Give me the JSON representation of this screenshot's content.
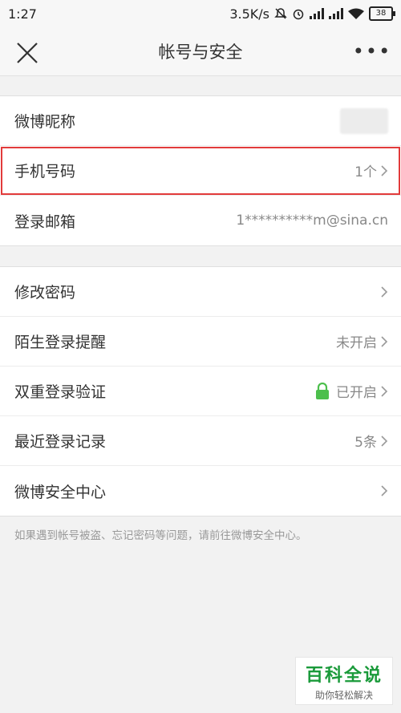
{
  "status": {
    "time": "1:27",
    "speed": "3.5K/s",
    "battery": "38"
  },
  "nav": {
    "title": "帐号与安全",
    "more": "•••"
  },
  "group1": [
    {
      "label": "微博昵称",
      "value": ""
    },
    {
      "label": "手机号码",
      "value": "1个"
    },
    {
      "label": "登录邮箱",
      "value": "1**********m@sina.cn"
    }
  ],
  "group2": [
    {
      "label": "修改密码",
      "value": ""
    },
    {
      "label": "陌生登录提醒",
      "value": "未开启"
    },
    {
      "label": "双重登录验证",
      "value": "已开启"
    },
    {
      "label": "最近登录记录",
      "value": "5条"
    },
    {
      "label": "微博安全中心",
      "value": ""
    }
  ],
  "footnote": "如果遇到帐号被盗、忘记密码等问题，请前往微博安全中心。",
  "watermark": {
    "title": "百科全说",
    "subtitle": "助你轻松解决"
  },
  "colors": {
    "accent_green": "#1a9a3a",
    "highlight_red": "#e23b3b",
    "lock_green": "#4cbf4c"
  }
}
